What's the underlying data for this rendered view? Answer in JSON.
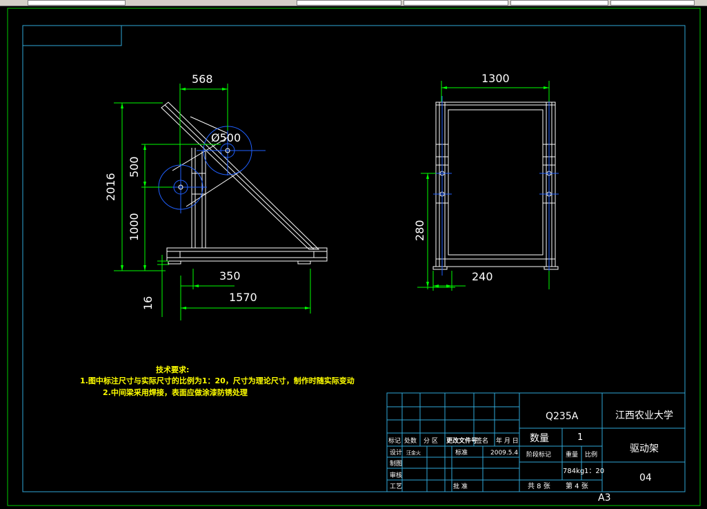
{
  "colors": {
    "background": "#000000",
    "sheet_border": "#00cc00",
    "frame": "#2fa8d8",
    "geometry": "#ffffff",
    "dimension": "#00ff00",
    "dim_text": "#ffffff",
    "circles": "#2060ff",
    "notes": "#ffff00",
    "title_text": "#ffffff"
  },
  "front_view": {
    "dims": {
      "top_width": "568",
      "pulley_dia": "Ø500",
      "height_total": "2016",
      "upper_offset": "500",
      "lower_height": "1000",
      "base_length": "1570",
      "inner_width": "350",
      "foot_height": "16"
    }
  },
  "side_view": {
    "dims": {
      "width": "1300",
      "bearing_height": "280",
      "foot_spacing": "240"
    }
  },
  "notes": {
    "title": "技术要求:",
    "line1": "1.图中标注尺寸与实际尺寸的比例为1：20，尺寸为理论尺寸，制作时随实际变动",
    "line2": "2.中间梁采用焊接，表面应做涂漆防锈处理"
  },
  "title_block": {
    "material": "Q235A",
    "school": "江西农业大学",
    "quantity_label": "数量",
    "quantity": "1",
    "part_name": "驱动架",
    "drawing_no": "04",
    "row_headers": [
      "标记",
      "处数",
      "分 区",
      "更改文件号",
      "签名",
      "年 月 日"
    ],
    "designer_label": "设计",
    "designer": "汪金火",
    "standard_label": "标准",
    "date": "2009.5.4",
    "draw_label": "制图",
    "review_label": "审核",
    "process_label": "工艺",
    "approve_label": "批 准",
    "stage_label": "阶段标记",
    "weight_label": "重量",
    "scale_label": "比例",
    "weight": "784kg",
    "scale": "1：20",
    "sheets_total": "共 8 张",
    "sheet_no": "第 4 张",
    "paper_size": "A3"
  }
}
